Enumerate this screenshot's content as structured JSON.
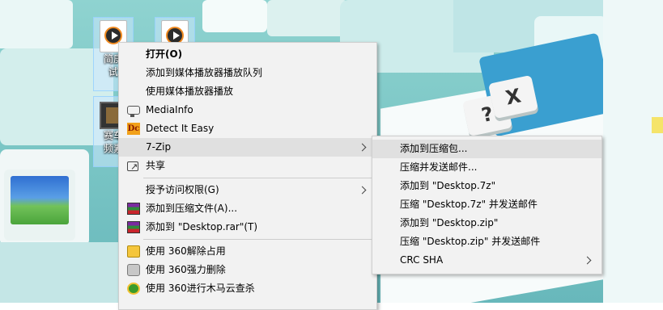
{
  "desktop": {
    "icons": [
      {
        "label": "简庚",
        "label2": "试",
        "type": "media-file"
      },
      {
        "label": "",
        "label2": "",
        "type": "media-file"
      },
      {
        "label": "赛车",
        "label2": "频素",
        "type": "video-file"
      }
    ],
    "keys": {
      "question": "?",
      "x": "X"
    }
  },
  "context_menu": {
    "items": [
      {
        "label": "打开(O)",
        "bold": true
      },
      {
        "label": "添加到媒体播放器播放队列"
      },
      {
        "label": "使用媒体播放器播放"
      },
      {
        "label": "MediaInfo",
        "icon": "mediainfo-icon"
      },
      {
        "label": "Detect It Easy",
        "icon": "detect-it-easy-icon",
        "icon_text": "Dc"
      },
      {
        "label": "7-Zip",
        "submenu": true,
        "highlighted": true
      },
      {
        "label": "共享",
        "icon": "share-icon"
      },
      {
        "label": "授予访问权限(G)",
        "submenu": true
      },
      {
        "label": "添加到压缩文件(A)...",
        "icon": "winrar-icon"
      },
      {
        "label": "添加到 \"Desktop.rar\"(T)",
        "icon": "winrar-icon"
      },
      {
        "label": "使用 360解除占用",
        "icon": "360-unlock-icon"
      },
      {
        "label": "使用 360强力删除",
        "icon": "360-delete-icon"
      },
      {
        "label": "使用 360进行木马云查杀",
        "icon": "360-scan-icon"
      }
    ]
  },
  "zip_submenu": {
    "items": [
      {
        "label": "添加到压缩包...",
        "highlighted": true
      },
      {
        "label": "压缩并发送邮件..."
      },
      {
        "label": "添加到 \"Desktop.7z\""
      },
      {
        "label": "压缩 \"Desktop.7z\" 并发送邮件"
      },
      {
        "label": "添加到 \"Desktop.zip\""
      },
      {
        "label": "压缩 \"Desktop.zip\" 并发送邮件"
      },
      {
        "label": "CRC SHA",
        "submenu": true
      }
    ]
  }
}
